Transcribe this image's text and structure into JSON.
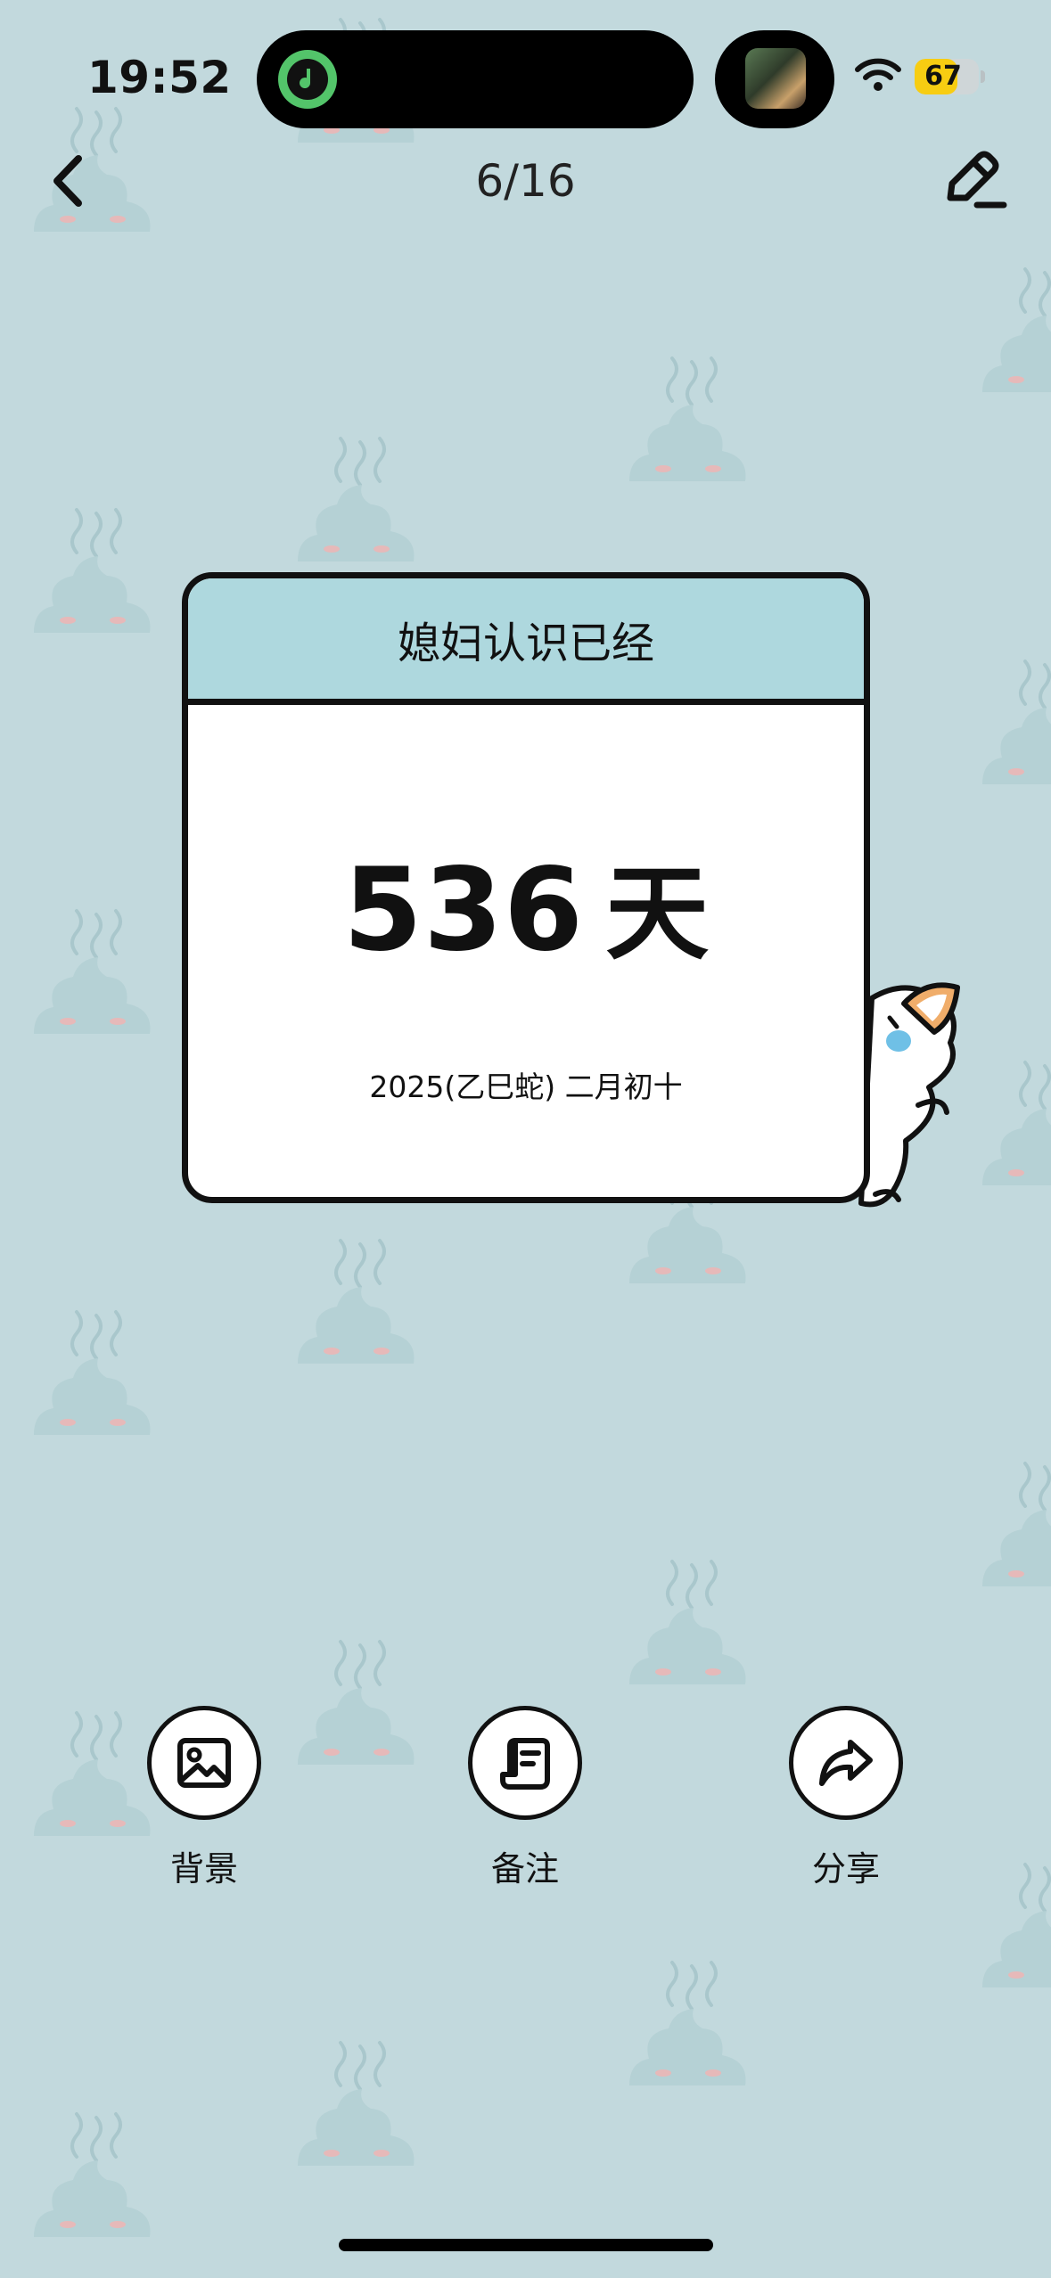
{
  "status_bar": {
    "time": "19:52",
    "battery_level": "67",
    "battery_color": "#f7cd12",
    "icons": [
      "music-app-icon",
      "album-art-thumbnail",
      "wifi-icon",
      "battery-icon"
    ]
  },
  "nav": {
    "page_counter": "6/16",
    "back_icon": "chevron-left-icon",
    "edit_icon": "pencil-edit-icon"
  },
  "card": {
    "title": "媳妇认识已经",
    "number": "536",
    "unit": "天",
    "date": "2025(乙巳蛇) 二月初十",
    "header_color": "#aed8de"
  },
  "actions": [
    {
      "label": "背景",
      "icon": "image-icon"
    },
    {
      "label": "备注",
      "icon": "note-scroll-icon"
    },
    {
      "label": "分享",
      "icon": "share-arrow-icon"
    }
  ],
  "theme": {
    "background": "#c2d9dd"
  }
}
